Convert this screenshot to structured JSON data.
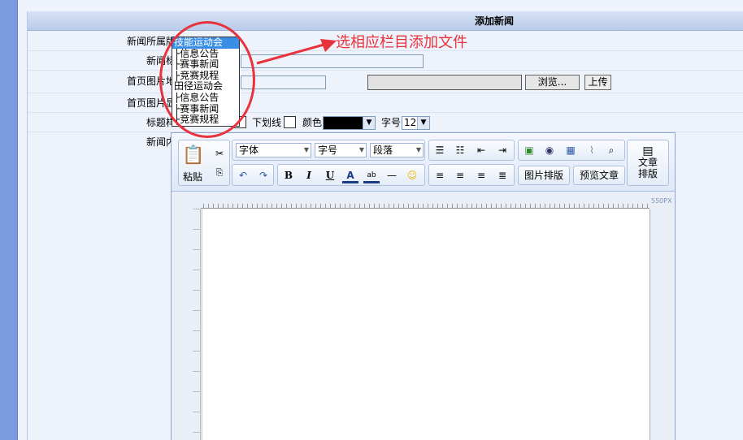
{
  "panel": {
    "title": "添加新闻"
  },
  "form": {
    "section_label": "新闻所属版面:",
    "title_label": "新闻标题:",
    "image_url_label": "首页图片地址:",
    "image_show_label": "首页图片显示:",
    "style_label": "标题样式:",
    "content_label": "新闻内容:",
    "browse_label": "浏览...",
    "upload_label": "上传",
    "underline_label": "下划线",
    "color_label": "颜色",
    "color_value": "#000000",
    "fontsize_label": "字号",
    "fontsize_value": "12"
  },
  "dropdown": {
    "items": [
      {
        "label": "技能运动会",
        "selected": true
      },
      {
        "label": "├信息公告"
      },
      {
        "label": "├赛事新闻"
      },
      {
        "label": "├竞赛规程"
      },
      {
        "label": "田径运动会"
      },
      {
        "label": "├信息公告"
      },
      {
        "label": "├赛事新闻"
      },
      {
        "label": "├竞赛规程"
      }
    ]
  },
  "editor": {
    "paste_label": "粘贴",
    "font_select": "字体",
    "size_select": "字号",
    "para_select": "段落",
    "image_layout_label": "图片排版",
    "preview_label": "预览文章",
    "article_layout_label": "文章排版",
    "ruler_label": "550PX"
  },
  "annotation": {
    "text": "选相应栏目添加文件"
  },
  "colors": {
    "accent": "#e8323c",
    "selection": "#3a8ee6"
  }
}
